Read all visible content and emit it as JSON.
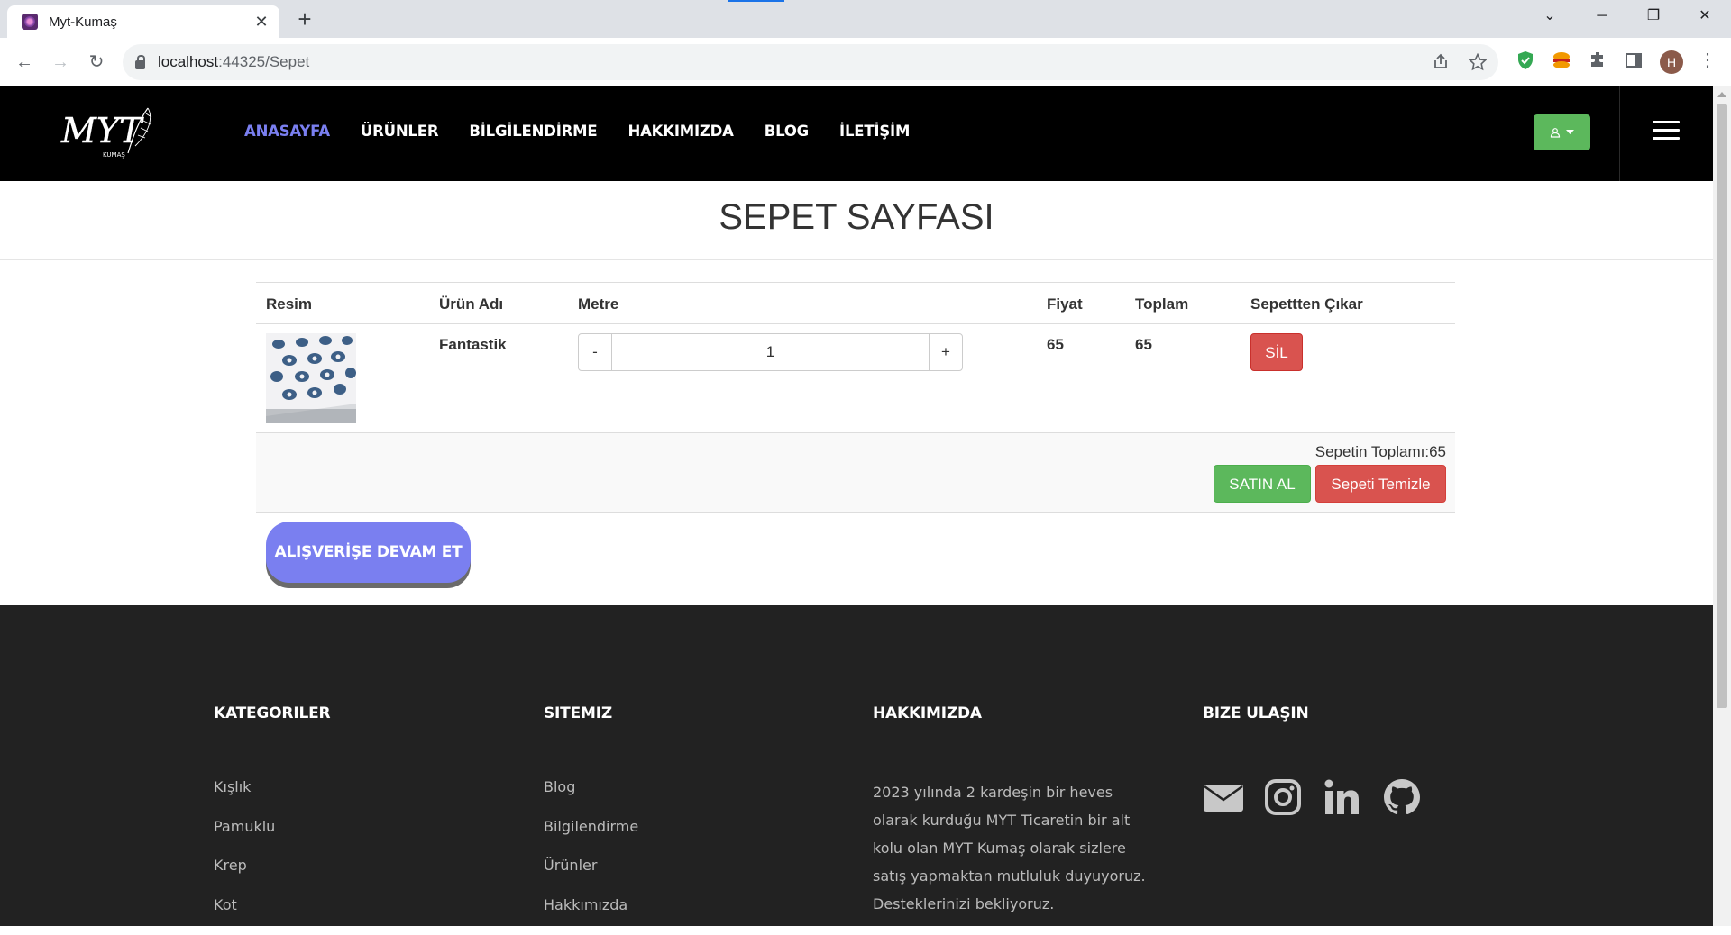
{
  "browser": {
    "tab_title": "Myt-Kumaş",
    "tab_close": "✕",
    "new_tab": "+",
    "url_host": "localhost",
    "url_rest": ":44325/Sepet",
    "avatar_initial": "H"
  },
  "header": {
    "nav": [
      "ANASAYFA",
      "ÜRÜNLER",
      "BİLGİLENDİRME",
      "HAKKIMIZDA",
      "BLOG",
      "İLETİŞİM"
    ],
    "active_nav": "ANASAYFA",
    "logo_text": "MYT",
    "logo_sub": "KUMAŞ",
    "accent": "#7a7ff0"
  },
  "page": {
    "title": "SEPET SAYFASI"
  },
  "cart": {
    "columns": [
      "Resim",
      "Ürün Adı",
      "Metre",
      "Fiyat",
      "Toplam",
      "Sepettten Çıkar"
    ],
    "items": [
      {
        "name": "Fantastik",
        "quantity": "1",
        "price": "65",
        "total": "65",
        "remove_label": "SİL",
        "minus": "-",
        "plus": "+"
      }
    ],
    "total_text": "Sepetin Toplamı:65",
    "buy_label": "SATIN AL",
    "clear_label": "Sepeti Temizle",
    "continue_label": "ALIŞVERİŞE DEVAM ET"
  },
  "footer": {
    "categories_title": "KATEGORILER",
    "categories": [
      "Kışlık",
      "Pamuklu",
      "Krep",
      "Kot"
    ],
    "site_title": "SITEMIZ",
    "site_links": [
      "Blog",
      "Bilgilendirme",
      "Ürünler",
      "Hakkımızda"
    ],
    "about_title": "HAKKIMIZDA",
    "about_text": "2023 yılında 2 kardeşin bir heves olarak kurduğu MYT Ticaretin bir alt kolu olan MYT Kumaş olarak sizlere satış yapmaktan mutluluk duyuyoruz. Desteklerinizi bekliyoruz.",
    "contact_title": "BIZE ULAŞIN",
    "socials": [
      "envelope-icon",
      "instagram-icon",
      "linkedin-icon",
      "github-icon"
    ]
  },
  "colors": {
    "success": "#5cb85c",
    "danger": "#d9534f",
    "footer_bg": "#222222"
  }
}
